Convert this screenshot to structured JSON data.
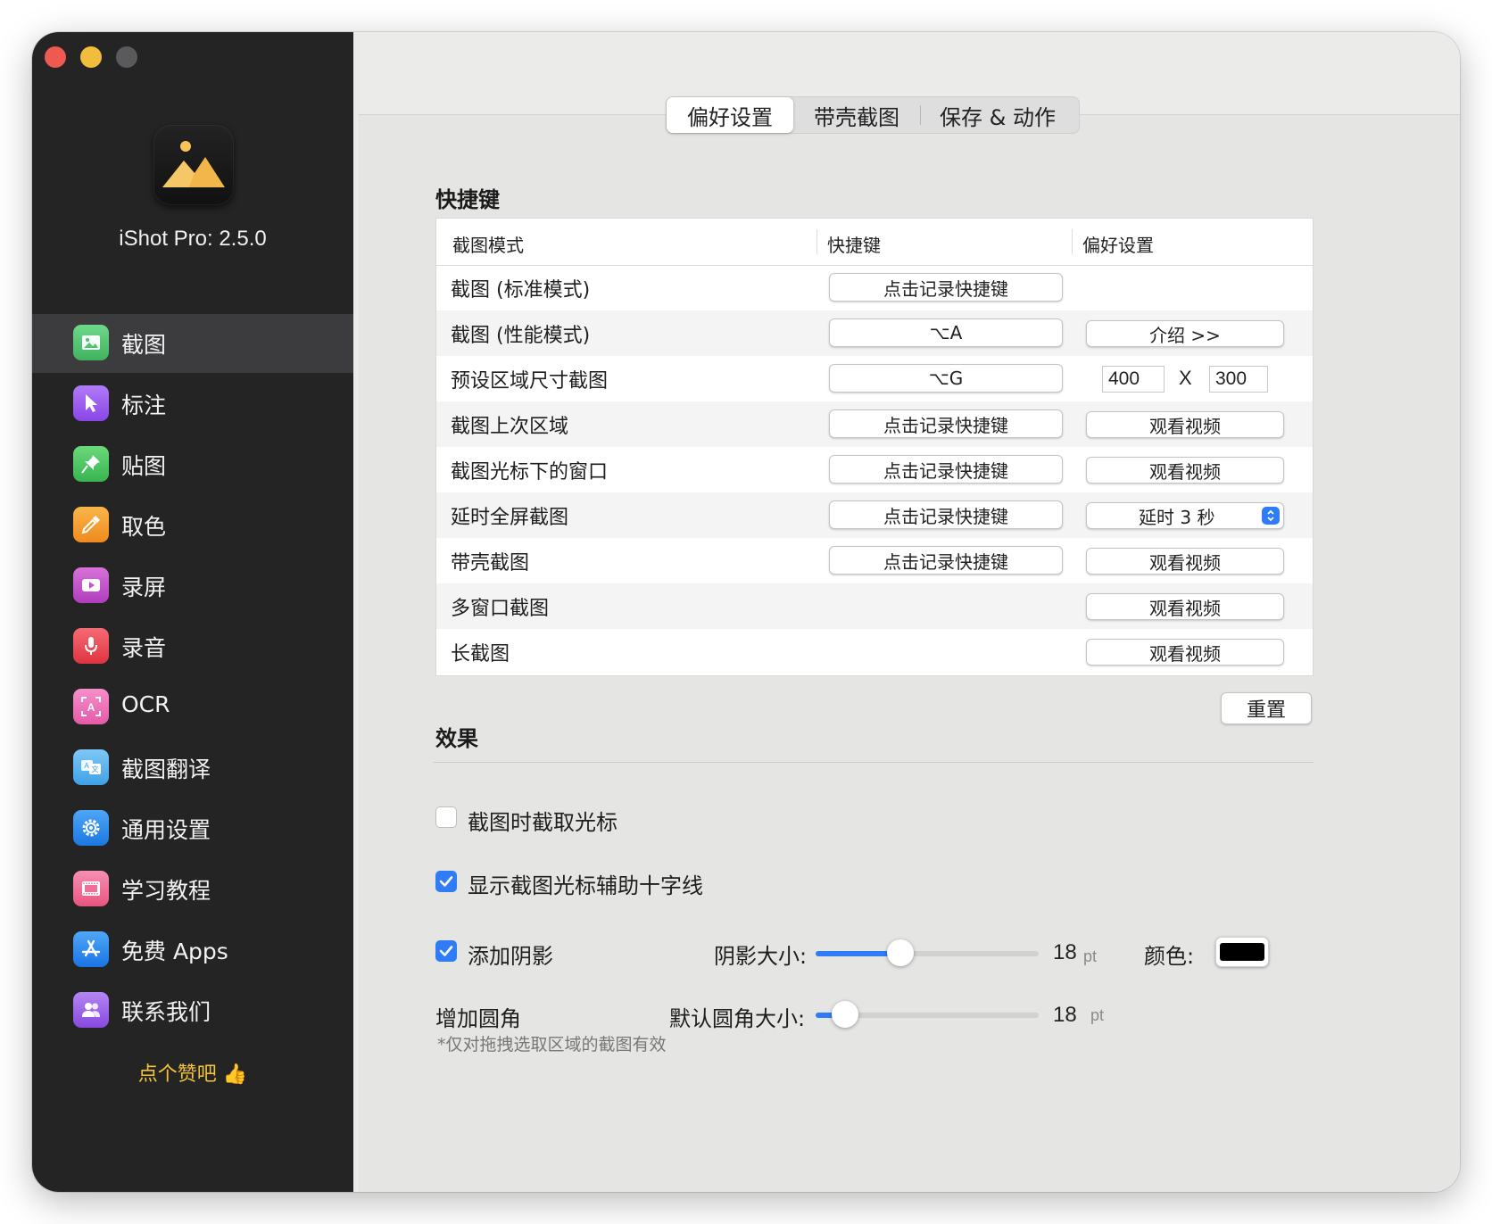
{
  "app": {
    "version_label": "iShot Pro: 2.5.0",
    "like_text": "点个赞吧 👍"
  },
  "sidebar": {
    "items": [
      {
        "label": "截图",
        "icon": "image-icon",
        "color": "#4ec26e"
      },
      {
        "label": "标注",
        "icon": "pointer-icon",
        "color": "#9b59f0"
      },
      {
        "label": "贴图",
        "icon": "pin-icon",
        "color": "#4cc760"
      },
      {
        "label": "取色",
        "icon": "eyedropper-icon",
        "color": "#f59c2a"
      },
      {
        "label": "录屏",
        "icon": "video-icon",
        "color": "#c552c8"
      },
      {
        "label": "录音",
        "icon": "mic-icon",
        "color": "#ee4d58"
      },
      {
        "label": "OCR",
        "icon": "ocr-icon",
        "color": "#ec6fb8"
      },
      {
        "label": "截图翻译",
        "icon": "translate-icon",
        "color": "#5cb6f2"
      },
      {
        "label": "通用设置",
        "icon": "gear-icon",
        "color": "#2c8ef0"
      },
      {
        "label": "学习教程",
        "icon": "film-icon",
        "color": "#f06e9a"
      },
      {
        "label": "免费 Apps",
        "icon": "appstore-icon",
        "color": "#2f8cf2"
      },
      {
        "label": "联系我们",
        "icon": "contacts-icon",
        "color": "#9d62e8"
      }
    ],
    "active_index": 0
  },
  "tabs": [
    {
      "label": "偏好设置",
      "selected": true
    },
    {
      "label": "带壳截图",
      "selected": false
    },
    {
      "label": "保存 & 动作",
      "selected": false
    }
  ],
  "shortcuts": {
    "title": "快捷键",
    "columns": [
      "截图模式",
      "快捷键",
      "偏好设置"
    ],
    "rows": [
      {
        "mode": "截图 (标准模式)",
        "shortcut": "点击记录快捷键",
        "pref": ""
      },
      {
        "mode": "截图 (性能模式)",
        "shortcut": "⌥A",
        "pref": "介绍  >>"
      },
      {
        "mode": "预设区域尺寸截图",
        "shortcut": "⌥G",
        "pref": ""
      },
      {
        "mode": "截图上次区域",
        "shortcut": "点击记录快捷键",
        "pref": "观看视频"
      },
      {
        "mode": "截图光标下的窗口",
        "shortcut": "点击记录快捷键",
        "pref": "观看视频"
      },
      {
        "mode": "延时全屏截图",
        "shortcut": "点击记录快捷键",
        "pref": "延时 3 秒"
      },
      {
        "mode": "带壳截图",
        "shortcut": "点击记录快捷键",
        "pref": "观看视频"
      },
      {
        "mode": "多窗口截图",
        "shortcut": "",
        "pref": "观看视频"
      },
      {
        "mode": "长截图",
        "shortcut": "",
        "pref": "观看视频"
      }
    ],
    "preset_width": "400",
    "preset_x": "X",
    "preset_height": "300",
    "reset_label": "重置"
  },
  "effects": {
    "title": "效果",
    "capture_cursor": {
      "label": "截图时截取光标",
      "checked": false
    },
    "show_crosshair": {
      "label": "显示截图光标辅助十字线",
      "checked": true
    },
    "add_shadow": {
      "label": "添加阴影",
      "checked": true
    },
    "shadow_size_label": "阴影大小:",
    "shadow_size_value": "18",
    "shadow_size_fraction": 0.38,
    "unit": "pt",
    "color_label": "颜色:",
    "shadow_color": "#000000",
    "corner_label": "增加圆角",
    "corner_size_label": "默认圆角大小:",
    "corner_size_value": "18",
    "corner_size_fraction": 0.13,
    "corner_note": "*仅对拖拽选取区域的截图有效"
  },
  "colors": {
    "accent": "#2f7cf6",
    "sidebar_bg": "#242425",
    "like_yellow": "#f3c53a"
  }
}
